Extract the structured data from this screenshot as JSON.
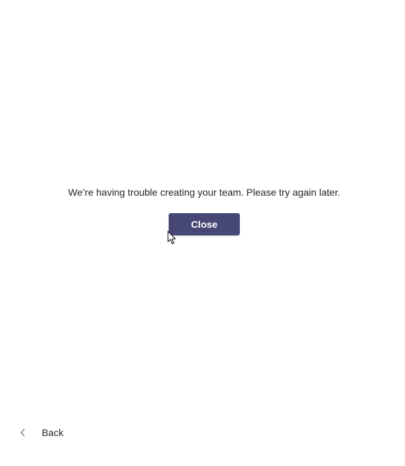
{
  "dialog": {
    "message": "We’re having trouble creating your team. Please try again later.",
    "close_label": "Close",
    "back_label": "Back"
  },
  "colors": {
    "primary_button": "#464775",
    "text": "#252423",
    "background": "#ffffff"
  },
  "icons": {
    "back": "chevron-left-icon",
    "pointer": "mouse-cursor-icon"
  }
}
